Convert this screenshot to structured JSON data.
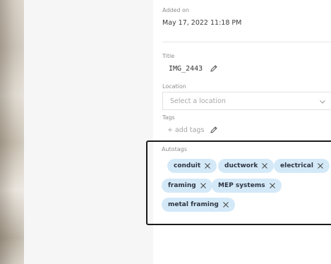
{
  "details": {
    "added_on_label": "Added on",
    "added_on_value": "May 17, 2022 11:18 PM",
    "title_label": "Title",
    "title_value": "IMG_2443",
    "location_label": "Location",
    "location_placeholder": "Select a location",
    "tags_label": "Tags",
    "add_tags_label": "+ add tags",
    "autotags_label": "Autotags",
    "autotags": [
      "conduit",
      "ductwork",
      "electrical",
      "framing",
      "MEP systems",
      "metal framing"
    ]
  },
  "icons": {
    "edit": "pencil-icon",
    "remove_tag": "close-icon",
    "dropdown": "chevron-down-icon"
  },
  "colors": {
    "chip_background": "#d4e9f8",
    "highlight_border": "#1b1b1b"
  }
}
